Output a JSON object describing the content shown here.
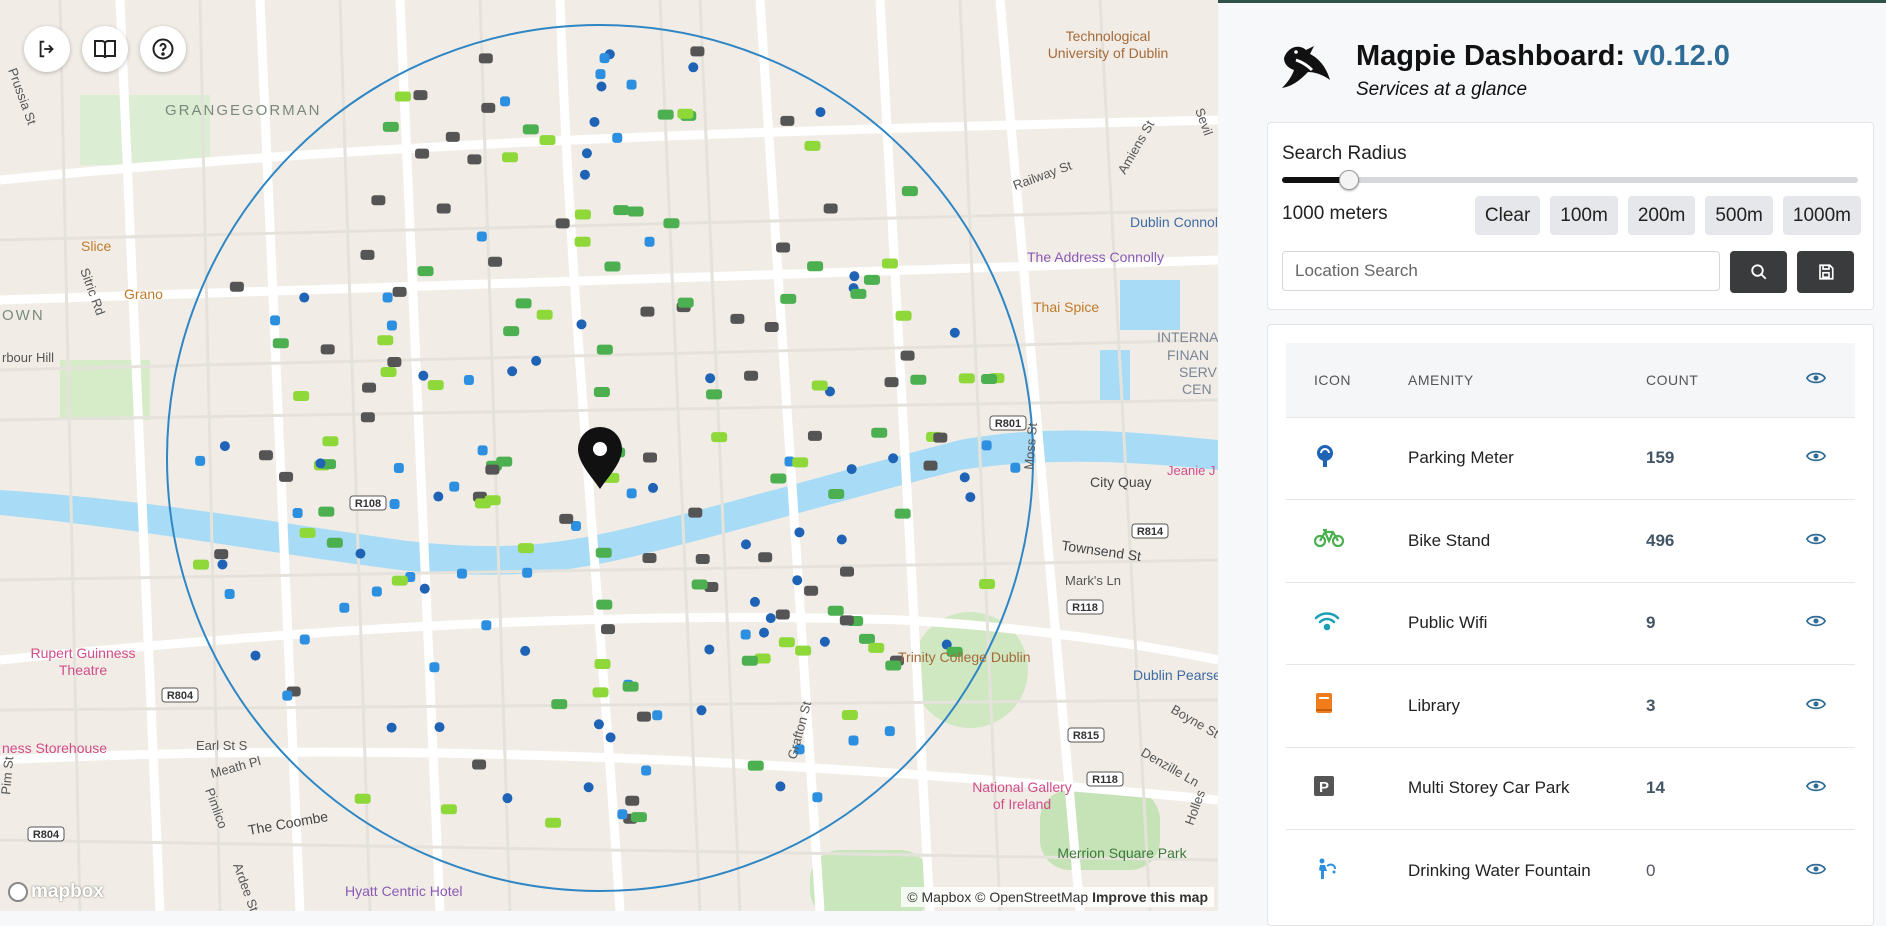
{
  "app": {
    "title": "Magpie Dashboard: ",
    "version": "v0.12.0",
    "subtitle": "Services at a glance"
  },
  "colors": {
    "accent": "#2e6c95",
    "radius_circle": "#2f86c5",
    "bike": "#4caf50",
    "bike_light": "#8fd83a",
    "parking_meter": "#1e63b5",
    "wifi": "#1aa0b5",
    "library": "#f07c1c",
    "car_park": "#555555",
    "fountain": "#2d8fe0",
    "river": "#a8dbf5"
  },
  "map": {
    "controls": [
      {
        "name": "logout-icon",
        "title": "Logout"
      },
      {
        "name": "book-icon",
        "title": "Guide"
      },
      {
        "name": "help-icon",
        "title": "Help"
      }
    ],
    "labels": [
      {
        "text": "GRANGEGORMAN",
        "kind": "area"
      },
      {
        "text": "Technological",
        "kind": "poi"
      },
      {
        "text": "University of Dublin",
        "kind": "poi"
      },
      {
        "text": "Dublin Connol",
        "kind": "station"
      },
      {
        "text": "The Address Connolly",
        "kind": "hotel"
      },
      {
        "text": "Thai Spice",
        "kind": "food"
      },
      {
        "text": "INTERNA",
        "kind": "area"
      },
      {
        "text": "FINAN",
        "kind": "area"
      },
      {
        "text": "SERV",
        "kind": "area"
      },
      {
        "text": "CEN",
        "kind": "area"
      },
      {
        "text": "Slice",
        "kind": "food"
      },
      {
        "text": "Grano",
        "kind": "food"
      },
      {
        "text": "Prussia St",
        "kind": "street"
      },
      {
        "text": "Sitric Rd",
        "kind": "street"
      },
      {
        "text": "OWN",
        "kind": "area"
      },
      {
        "text": "rbour Hill",
        "kind": "street"
      },
      {
        "text": "Railway St",
        "kind": "street"
      },
      {
        "text": "Amiens St",
        "kind": "street"
      },
      {
        "text": "Sevil",
        "kind": "street"
      },
      {
        "text": "City Quay",
        "kind": "street"
      },
      {
        "text": "Townsend St",
        "kind": "street"
      },
      {
        "text": "Mark's Ln",
        "kind": "street"
      },
      {
        "text": "Moss St",
        "kind": "street"
      },
      {
        "text": "Jeanie J",
        "kind": "poi"
      },
      {
        "text": "Trinity College Dublin",
        "kind": "poi"
      },
      {
        "text": "Dublin Pearse",
        "kind": "station"
      },
      {
        "text": "Boyne St",
        "kind": "street"
      },
      {
        "text": "Denzille Ln",
        "kind": "street"
      },
      {
        "text": "Holles",
        "kind": "street"
      },
      {
        "text": "National Gallery",
        "kind": "poi"
      },
      {
        "text": "of Ireland",
        "kind": "poi"
      },
      {
        "text": "Merrion Square Park",
        "kind": "park"
      },
      {
        "text": "Rupert Guinness",
        "kind": "poi"
      },
      {
        "text": "Theatre",
        "kind": "poi"
      },
      {
        "text": "ness Storehouse",
        "kind": "poi"
      },
      {
        "text": "Earl St S",
        "kind": "street"
      },
      {
        "text": "Meath Pl",
        "kind": "street"
      },
      {
        "text": "Pimlico",
        "kind": "street"
      },
      {
        "text": "The Coombe",
        "kind": "street"
      },
      {
        "text": "Ardee St",
        "kind": "street"
      },
      {
        "text": "Pim St",
        "kind": "street"
      },
      {
        "text": "Hyatt Centric Hotel",
        "kind": "hotel"
      },
      {
        "text": "Grafton St",
        "kind": "street"
      }
    ],
    "road_shields": [
      "R801",
      "R108",
      "R814",
      "R118",
      "R804",
      "R815",
      "R118",
      "R804"
    ],
    "attribution": {
      "mapbox": "© Mapbox",
      "osm": "© OpenStreetMap",
      "improve": "Improve this map"
    },
    "logo": "mapbox"
  },
  "search_radius": {
    "label": "Search Radius",
    "value_text": "1000 meters",
    "slider_fraction": 0.115,
    "presets": [
      "Clear",
      "100m",
      "200m",
      "500m",
      "1000m"
    ],
    "search_placeholder": "Location Search"
  },
  "table": {
    "headers": {
      "icon": "ICON",
      "amenity": "AMENITY",
      "count": "COUNT"
    },
    "rows": [
      {
        "icon": "parking-meter-icon",
        "amenity": "Parking Meter",
        "count": "159"
      },
      {
        "icon": "bike-icon",
        "amenity": "Bike Stand",
        "count": "496"
      },
      {
        "icon": "wifi-icon",
        "amenity": "Public Wifi",
        "count": "9"
      },
      {
        "icon": "library-icon",
        "amenity": "Library",
        "count": "3"
      },
      {
        "icon": "car-park-icon",
        "amenity": "Multi Storey Car Park",
        "count": "14"
      },
      {
        "icon": "fountain-icon",
        "amenity": "Drinking Water Fountain",
        "count": "0"
      }
    ]
  }
}
